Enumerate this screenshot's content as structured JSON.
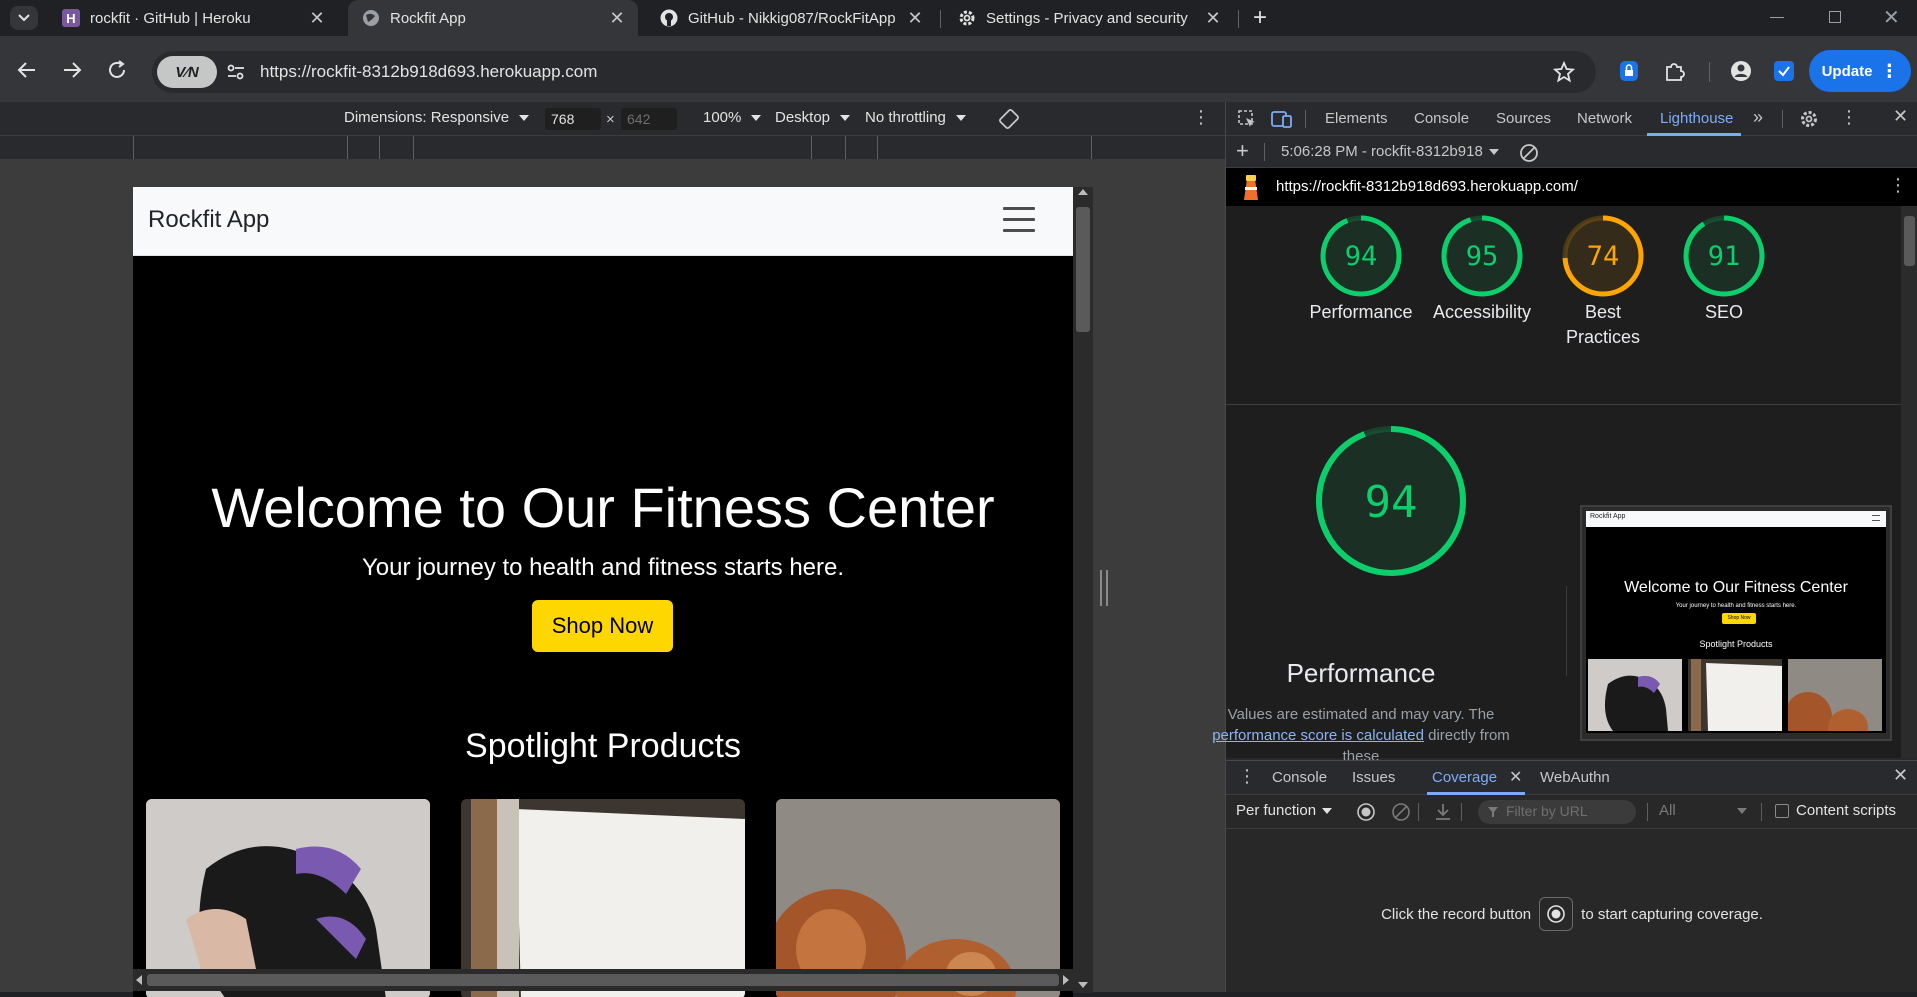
{
  "tabs": [
    {
      "title": "rockfit · GitHub | Heroku",
      "icon": "heroku-icon"
    },
    {
      "title": "Rockfit App",
      "icon": "globe-icon"
    },
    {
      "title": "GitHub - Nikkig087/RockFitApp",
      "icon": "github-icon"
    },
    {
      "title": "Settings - Privacy and security",
      "icon": "gear-icon"
    }
  ],
  "toolbar": {
    "url": "https://rockfit-8312b918d693.herokuapp.com",
    "vpn_label": "V∕N",
    "update_label": "Update"
  },
  "device_toolbar": {
    "dimensions": "Dimensions: Responsive",
    "width": "768",
    "times": "×",
    "height": "642",
    "zoom": "100%",
    "device_type": "Desktop",
    "throttling": "No throttling"
  },
  "site": {
    "brand": "Rockfit App",
    "hero_title": "Welcome to Our Fitness Center",
    "hero_subtitle": "Your journey to health and fitness starts here.",
    "shop_button": "Shop Now",
    "spotlight_title": "Spotlight Products"
  },
  "devtools": {
    "tabs": [
      "Elements",
      "Console",
      "Sources",
      "Network",
      "Lighthouse"
    ],
    "active_tab": "Lighthouse",
    "report_time": "5:06:28 PM - rockfit-8312b918",
    "report_url": "https://rockfit-8312b918d693.herokuapp.com/",
    "scores": [
      {
        "label": "Performance",
        "value": 94,
        "color": "#0cce6b"
      },
      {
        "label": "Accessibility",
        "value": 95,
        "color": "#0cce6b"
      },
      {
        "label": "Best Practices",
        "value": 74,
        "color": "#ffa400"
      },
      {
        "label": "SEO",
        "value": 91,
        "color": "#0cce6b"
      }
    ],
    "big_score": {
      "label": "Performance",
      "value": 94
    },
    "perf_note_1": "Values are estimated and may vary. The",
    "perf_note_link": "performance score is calculated",
    "perf_note_2": "directly from these",
    "thumb": {
      "brand": "Rockfit App",
      "title": "Welcome to Our Fitness Center",
      "subtitle": "Your journey to health and fitness starts here.",
      "button": "Shop Now",
      "spotlight": "Spotlight Products"
    }
  },
  "drawer": {
    "tabs": [
      "Console",
      "Issues",
      "Coverage",
      "WebAuthn"
    ],
    "active_tab": "Coverage",
    "per_function": "Per function",
    "filter_placeholder": "Filter by URL",
    "type_filter": "All",
    "content_scripts": "Content scripts",
    "msg_before": "Click the record button",
    "msg_after": "to start capturing coverage."
  }
}
